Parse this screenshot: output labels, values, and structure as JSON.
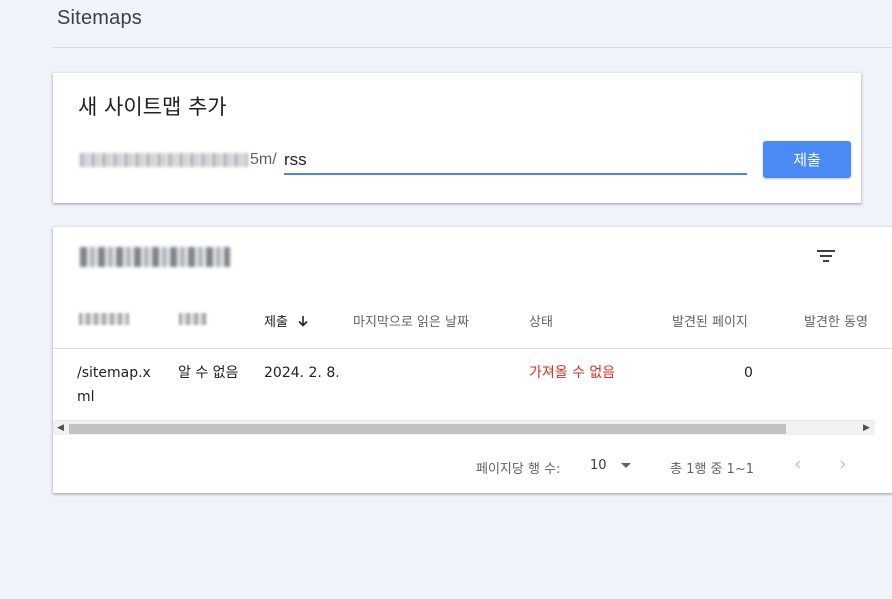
{
  "page": {
    "title": "Sitemaps"
  },
  "add_sitemap": {
    "title": "새 사이트맵 추가",
    "url_suffix": "5m/",
    "input_value": "rss",
    "submit_label": "제출"
  },
  "table": {
    "columns": {
      "submitted": "제출",
      "last_read": "마지막으로 읽은 날짜",
      "status": "상태",
      "discovered_pages": "발견된 페이지",
      "discovered_videos": "발견한 동영"
    },
    "rows": [
      {
        "sitemap": "/sitemap.xml",
        "type": "알 수 없음",
        "submitted": "2024. 2. 8.",
        "last_read": "",
        "status": "가져올 수 없음",
        "discovered_pages": "0",
        "discovered_videos": ""
      }
    ]
  },
  "pagination": {
    "rows_per_page_label": "페이지당 행 수:",
    "rows_per_page": "10",
    "range": "총 1행 중 1~1",
    "prev_icon": "chevron-left-icon",
    "next_icon": "chevron-right-icon"
  },
  "colors": {
    "accent": "#4a8af4",
    "error": "#d93025",
    "background": "#f1f3fb"
  }
}
